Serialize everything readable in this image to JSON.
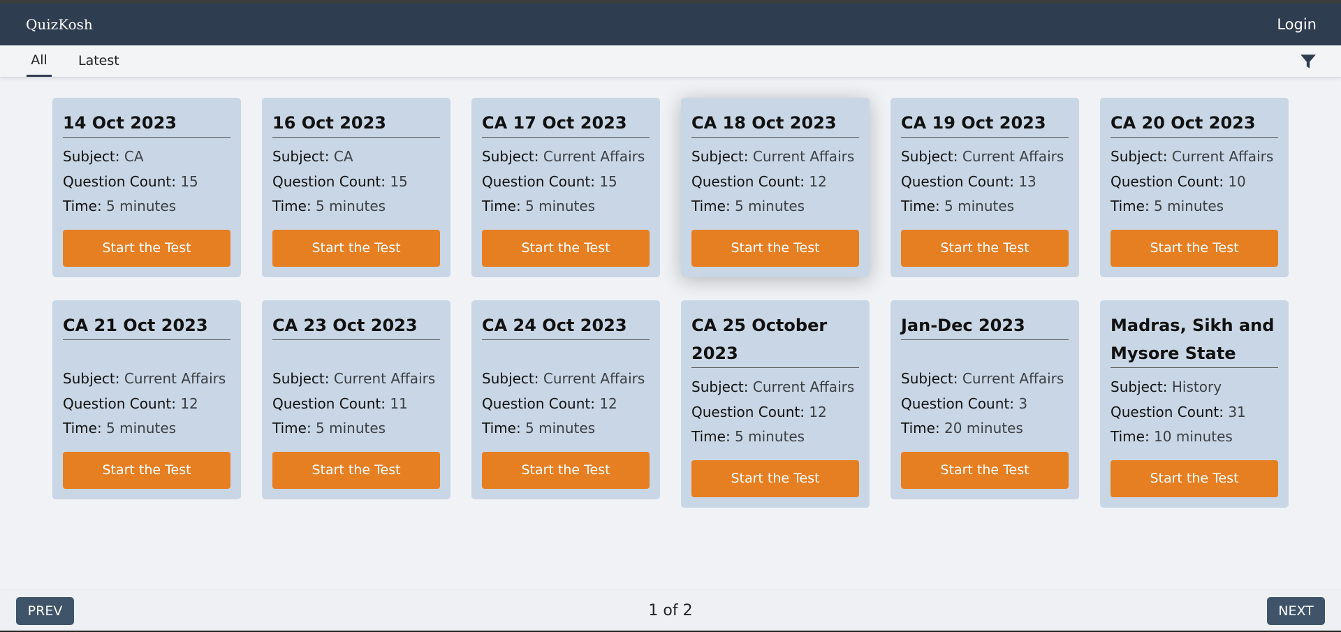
{
  "navbar": {
    "brand": "QuizKosh",
    "login": "Login"
  },
  "tabs": [
    {
      "label": "All"
    },
    {
      "label": "Latest"
    }
  ],
  "icons": {
    "filter": "filter-icon"
  },
  "colors": {
    "navbar": "#2e3d4f",
    "card": "#c9d6e5",
    "button": "#e67e22",
    "pager": "#3f5468"
  },
  "labels": {
    "subject": "Subject:",
    "count": "Question Count:",
    "time": "Time:"
  },
  "cards": [
    {
      "title": "14 Oct 2023",
      "subject": "CA",
      "count": "15",
      "time": "5 minutes",
      "button": "Start the Test"
    },
    {
      "title": "16 Oct 2023",
      "subject": "CA",
      "count": "15",
      "time": "5 minutes",
      "button": "Start the Test"
    },
    {
      "title": "CA 17 Oct 2023",
      "subject": "Current Affairs",
      "count": "15",
      "time": "5 minutes",
      "button": "Start the Test"
    },
    {
      "title": "CA 18 Oct 2023",
      "subject": "Current Affairs",
      "count": "12",
      "time": "5 minutes",
      "button": "Start the Test"
    },
    {
      "title": "CA 19 Oct 2023",
      "subject": "Current Affairs",
      "count": "13",
      "time": "5 minutes",
      "button": "Start the Test"
    },
    {
      "title": "CA 20 Oct 2023",
      "subject": "Current Affairs",
      "count": "10",
      "time": "5 minutes",
      "button": "Start the Test"
    },
    {
      "title": "CA 21 Oct 2023",
      "subject": "Current Affairs",
      "count": "12",
      "time": "5 minutes",
      "button": "Start the Test"
    },
    {
      "title": "CA 23 Oct 2023",
      "subject": "Current Affairs",
      "count": "11",
      "time": "5 minutes",
      "button": "Start the Test"
    },
    {
      "title": "CA 24 Oct 2023",
      "subject": "Current Affairs",
      "count": "12",
      "time": "5 minutes",
      "button": "Start the Test"
    },
    {
      "title": "CA 25 October 2023",
      "subject": "Current Affairs",
      "count": "12",
      "time": "5 minutes",
      "button": "Start the Test"
    },
    {
      "title": "Jan-Dec 2023",
      "subject": "Current Affairs",
      "count": "3",
      "time": "20 minutes",
      "button": "Start the Test"
    },
    {
      "title": "Madras, Sikh and Mysore State",
      "subject": "History",
      "count": "31",
      "time": "10 minutes",
      "button": "Start the Test"
    }
  ],
  "pagination": {
    "prev": "PREV",
    "info": "1 of 2",
    "next": "NEXT"
  }
}
